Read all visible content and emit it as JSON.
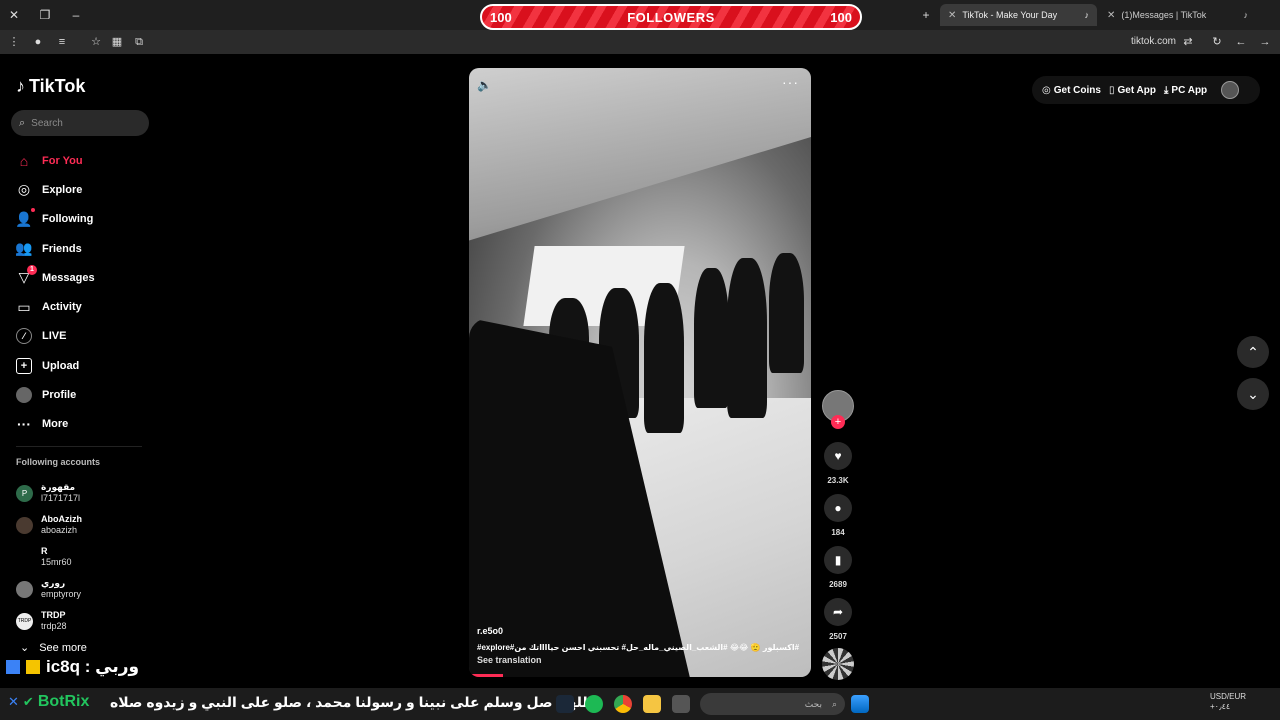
{
  "browser": {
    "followers_banner": {
      "left": "100",
      "label": "FOLLOWERS",
      "right": "100"
    },
    "tabs": [
      {
        "label": "TikTok - Make Your Day",
        "active": true
      },
      {
        "label": "(1)Messages | TikTok",
        "active": false
      }
    ],
    "url": "tiktok.com"
  },
  "sidebar": {
    "logo": "TikTok",
    "search_placeholder": "Search",
    "nav": [
      {
        "label": "For You",
        "icon": "home-icon",
        "active": true
      },
      {
        "label": "Explore",
        "icon": "compass-icon"
      },
      {
        "label": "Following",
        "icon": "following-icon"
      },
      {
        "label": "Friends",
        "icon": "friends-icon"
      },
      {
        "label": "Messages",
        "icon": "messages-icon",
        "badge": "1"
      },
      {
        "label": "Activity",
        "icon": "activity-icon"
      },
      {
        "label": "LIVE",
        "icon": "live-icon"
      },
      {
        "label": "Upload",
        "icon": "upload-icon"
      },
      {
        "label": "Profile",
        "icon": "profile-icon"
      },
      {
        "label": "More",
        "icon": "more-icon"
      }
    ],
    "following_title": "Following accounts",
    "following": [
      {
        "name": "مقهورة",
        "user": "l7171717l",
        "avatar": "P"
      },
      {
        "name": "AboAzizh",
        "user": "aboazizh",
        "avatar": ""
      },
      {
        "name": "R",
        "user": "15mr60",
        "avatar": ""
      },
      {
        "name": "روري",
        "user": "emptyrory",
        "avatar": ""
      },
      {
        "name": "TRDP",
        "user": "trdp28",
        "avatar": "TRDP"
      }
    ],
    "see_more": "See more",
    "overlay": "ic8q : وربي"
  },
  "video": {
    "author": "r.e5o0",
    "description": "#explore#اكسبلور 🫡 😂😂 #الشعب_الصيني_ماله_حل# تحسبني احسن حيااااتك من#",
    "see_translation": "See translation",
    "progress": 0.1
  },
  "actions": {
    "likes": "23.3K",
    "comments": "184",
    "saves": "2689",
    "shares": "2507"
  },
  "header": {
    "get_coins": "Get Coins",
    "get_app": "Get App",
    "pc_app": "PC App"
  },
  "taskbar": {
    "brand": "BotRix",
    "marquee": "اللهم صل وسلم على نبينا و رسولنا محمد ، صلو على النبي و زيدوه صلاه :",
    "search_placeholder": "بحث",
    "currency": "USD/EUR",
    "currency_change": "+٠٫٤٤"
  }
}
